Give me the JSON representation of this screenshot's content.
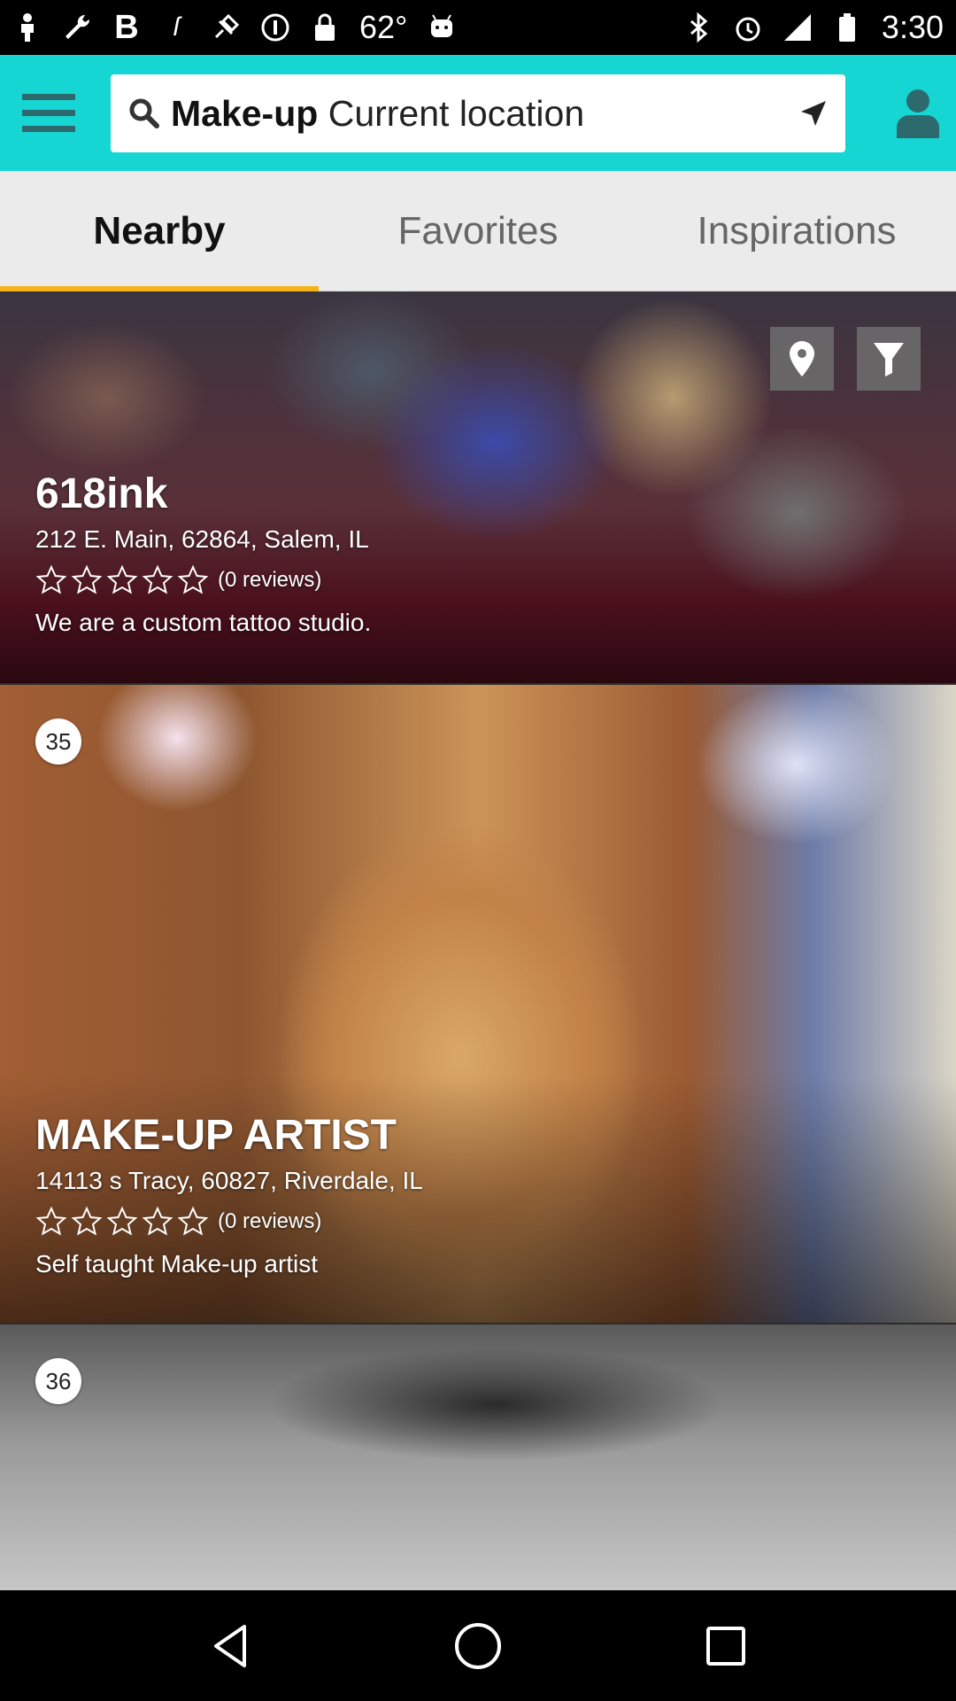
{
  "status_bar": {
    "temperature": "62°",
    "time": "3:30",
    "left_icons": [
      "person-pin-icon",
      "wrench-icon",
      "bold-b-icon",
      "swipe-icon",
      "fake-gps-icon",
      "info-icon",
      "lock-icon",
      "temperature-icon",
      "android-icon"
    ],
    "right_icons": [
      "bluetooth-icon",
      "alarm-icon",
      "signal-icon",
      "battery-icon"
    ]
  },
  "search": {
    "keyword": "Make-up",
    "location": "Current location"
  },
  "tabs": [
    {
      "label": "Nearby",
      "active": true
    },
    {
      "label": "Favorites",
      "active": false
    },
    {
      "label": "Inspirations",
      "active": false
    }
  ],
  "accent_colors": {
    "header": "#16d6d4",
    "active_tab_underline": "#f6b21a"
  },
  "listings": [
    {
      "name": "618ink",
      "address": "212 E. Main, 62864, Salem, IL",
      "reviews": "(0 reviews)",
      "rating": 0,
      "description": "We are a custom tattoo studio."
    },
    {
      "badge": "35",
      "name": "MAKE-UP ARTIST",
      "address": "14113 s Tracy, 60827, Riverdale, IL",
      "reviews": "(0 reviews)",
      "rating": 0,
      "description": "Self taught Make-up artist"
    },
    {
      "badge": "36"
    }
  ]
}
